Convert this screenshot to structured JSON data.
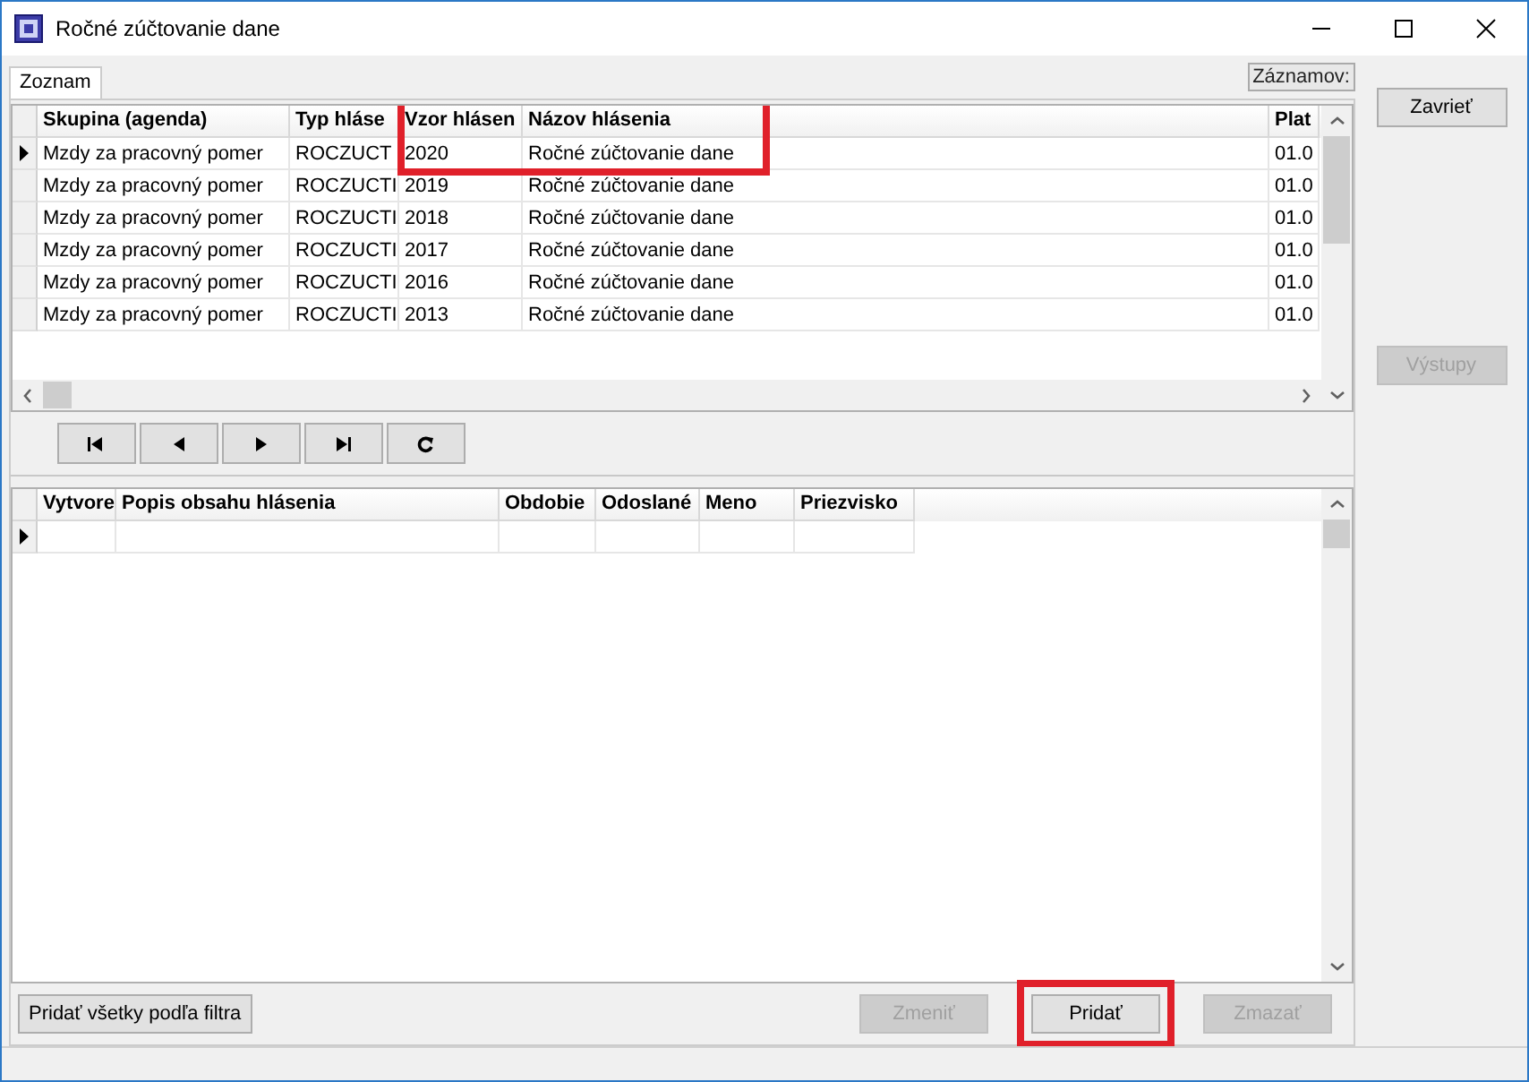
{
  "window": {
    "title": "Ročné zúčtovanie dane"
  },
  "tabs": [
    {
      "label": "Zoznam",
      "selected": true
    }
  ],
  "record_count": "Záznamov:",
  "reports_table": {
    "highlight_frame": true,
    "columns": [
      "Skupina (agenda)",
      "Typ hláse",
      "Vzor hlásen",
      "Názov hlásenia",
      "Plat"
    ],
    "rows": [
      {
        "selected": true,
        "cells": [
          "Mzdy za pracovný pomer",
          "ROCZUCT",
          "2020",
          "Ročné zúčtovanie dane",
          "01.0"
        ]
      },
      {
        "selected": false,
        "cells": [
          "Mzdy za pracovný pomer",
          "ROCZUCTI",
          "2019",
          "Ročné zúčtovanie dane",
          "01.0"
        ]
      },
      {
        "selected": false,
        "cells": [
          "Mzdy za pracovný pomer",
          "ROCZUCTI",
          "2018",
          "Ročné zúčtovanie dane",
          "01.0"
        ]
      },
      {
        "selected": false,
        "cells": [
          "Mzdy za pracovný pomer",
          "ROCZUCTI",
          "2017",
          "Ročné zúčtovanie dane",
          "01.0"
        ]
      },
      {
        "selected": false,
        "cells": [
          "Mzdy za pracovný pomer",
          "ROCZUCTI",
          "2016",
          "Ročné zúčtovanie dane",
          "01.0"
        ]
      },
      {
        "selected": false,
        "cells": [
          "Mzdy za pracovný pomer",
          "ROCZUCTI",
          "2013",
          "Ročné zúčtovanie dane",
          "01.0"
        ]
      }
    ]
  },
  "navigator": [
    {
      "kind": "first"
    },
    {
      "kind": "prev"
    },
    {
      "kind": "next"
    },
    {
      "kind": "last"
    },
    {
      "kind": "refresh"
    }
  ],
  "content_table": {
    "columns": [
      "Vytvore",
      "Popis obsahu hlásenia",
      "Obdobie",
      "Odoslané",
      "Meno",
      "Priezvisko"
    ],
    "rows": [
      {
        "selected": true
      }
    ]
  },
  "bottom_buttons": [
    {
      "label": "Pridať všetky podľa filtra",
      "disabled": false,
      "highlighted": false
    },
    {
      "label": "Zmeniť",
      "disabled": true,
      "highlighted": false
    },
    {
      "label": "Pridať",
      "disabled": false,
      "highlighted": true
    },
    {
      "label": "Zmazať",
      "disabled": true,
      "highlighted": false
    }
  ],
  "side_buttons": [
    {
      "label": "Zavrieť",
      "disabled": false
    },
    {
      "label": "Výstupy",
      "disabled": true
    }
  ]
}
